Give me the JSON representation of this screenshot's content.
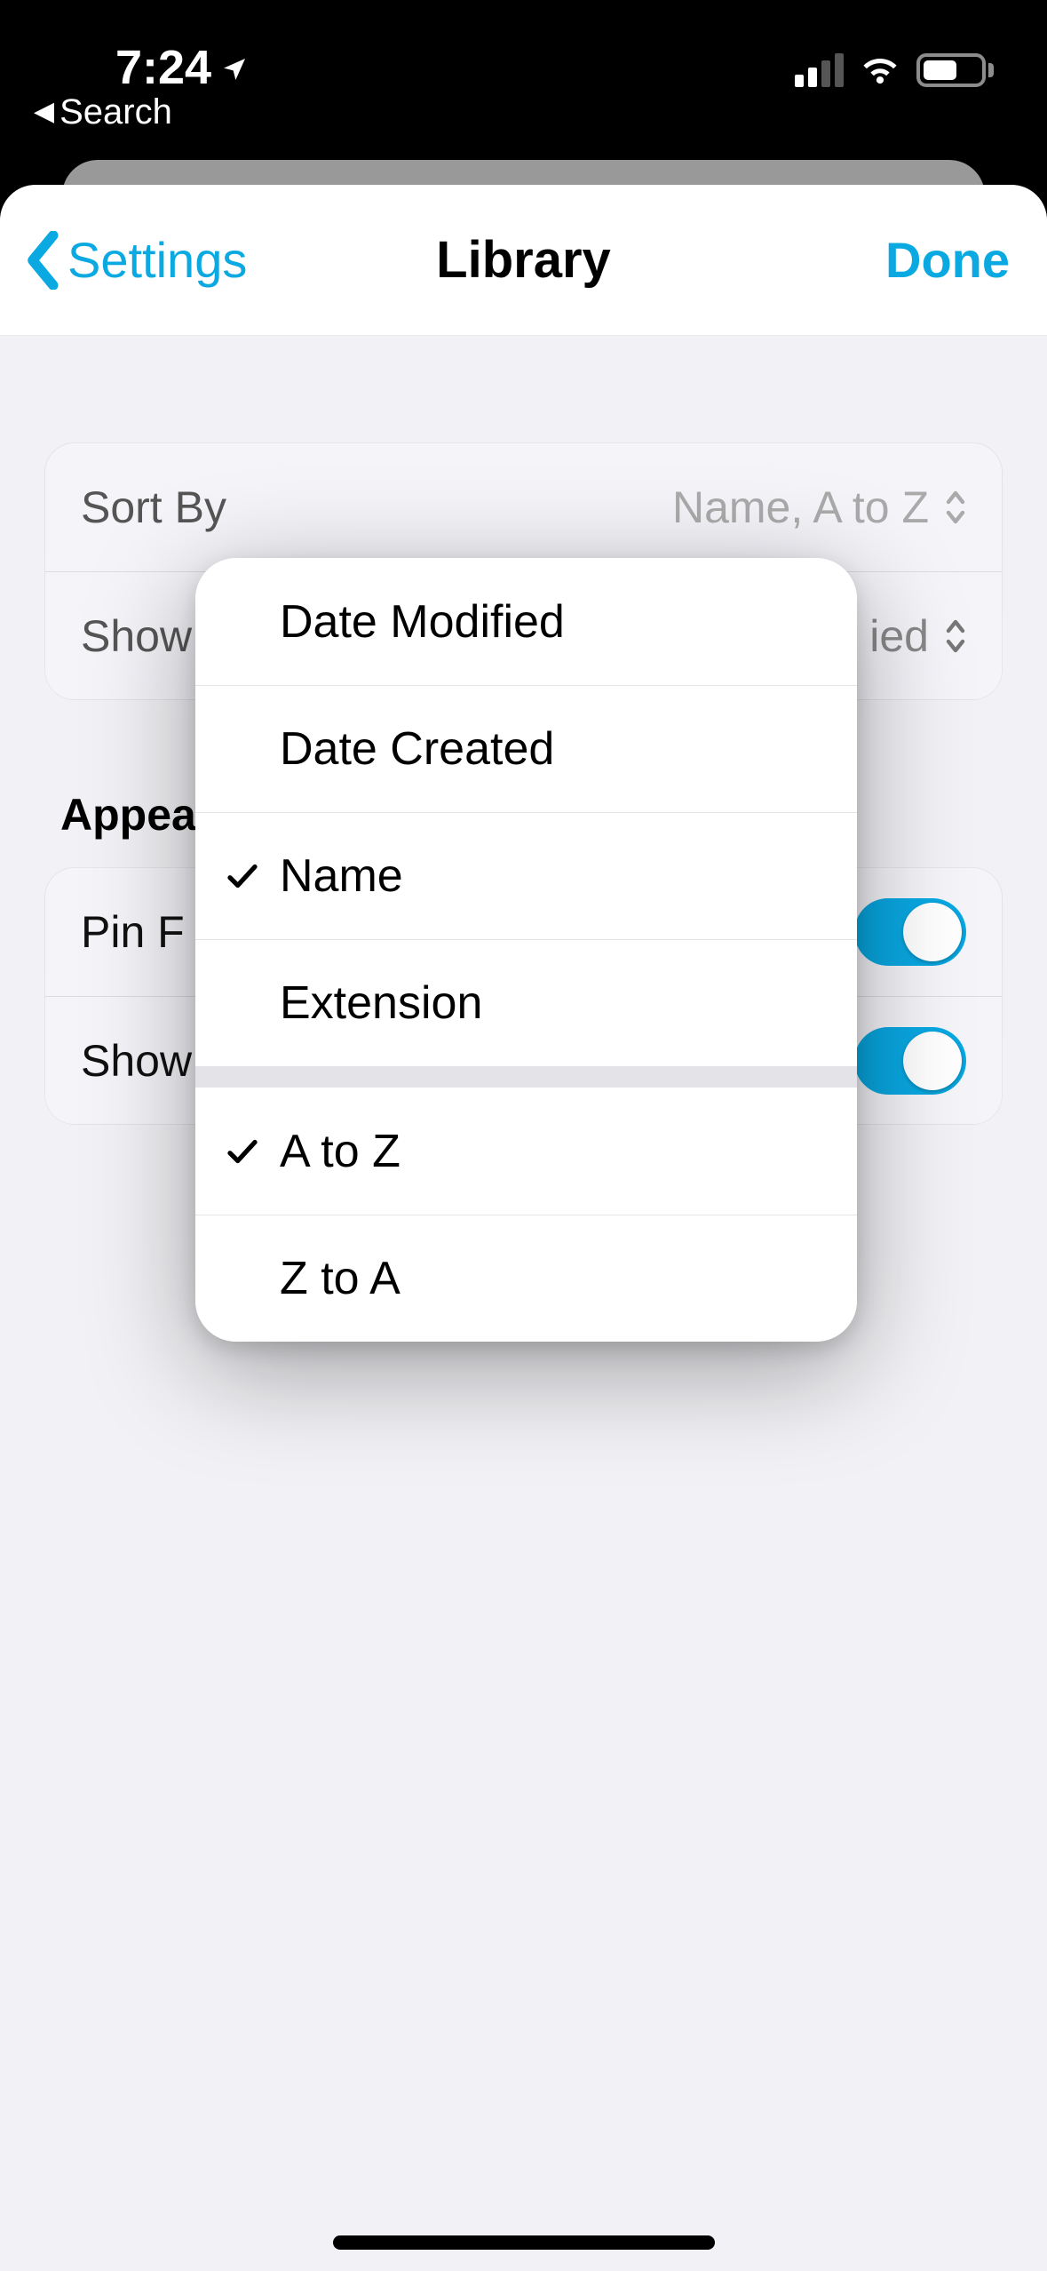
{
  "status": {
    "time": "7:24",
    "back_app": "Search"
  },
  "nav": {
    "back_label": "Settings",
    "title": "Library",
    "done": "Done"
  },
  "sort_group": {
    "sort_by_label": "Sort By",
    "sort_by_value": "Name, A to Z",
    "show_label": "Show",
    "show_value_partial": "ied"
  },
  "appearance": {
    "section_title": "Appearance",
    "pin_label_partial": "Pin F",
    "show_label_partial": "Show",
    "pin_toggle_on": true,
    "show_toggle_on": true
  },
  "menu": {
    "items_primary": [
      {
        "label": "Date Modified",
        "checked": false
      },
      {
        "label": "Date Created",
        "checked": false
      },
      {
        "label": "Name",
        "checked": true
      },
      {
        "label": "Extension",
        "checked": false
      }
    ],
    "items_secondary": [
      {
        "label": "A to Z",
        "checked": true
      },
      {
        "label": "Z to A",
        "checked": false
      }
    ]
  },
  "colors": {
    "accent": "#0aa9e2"
  }
}
